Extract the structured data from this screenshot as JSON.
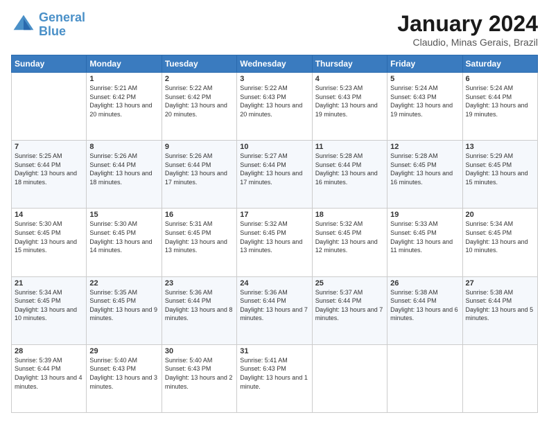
{
  "header": {
    "logo_line1": "General",
    "logo_line2": "Blue",
    "month": "January 2024",
    "location": "Claudio, Minas Gerais, Brazil"
  },
  "weekdays": [
    "Sunday",
    "Monday",
    "Tuesday",
    "Wednesday",
    "Thursday",
    "Friday",
    "Saturday"
  ],
  "weeks": [
    [
      {
        "day": "",
        "sunrise": "",
        "sunset": "",
        "daylight": ""
      },
      {
        "day": "1",
        "sunrise": "Sunrise: 5:21 AM",
        "sunset": "Sunset: 6:42 PM",
        "daylight": "Daylight: 13 hours and 20 minutes."
      },
      {
        "day": "2",
        "sunrise": "Sunrise: 5:22 AM",
        "sunset": "Sunset: 6:42 PM",
        "daylight": "Daylight: 13 hours and 20 minutes."
      },
      {
        "day": "3",
        "sunrise": "Sunrise: 5:22 AM",
        "sunset": "Sunset: 6:43 PM",
        "daylight": "Daylight: 13 hours and 20 minutes."
      },
      {
        "day": "4",
        "sunrise": "Sunrise: 5:23 AM",
        "sunset": "Sunset: 6:43 PM",
        "daylight": "Daylight: 13 hours and 19 minutes."
      },
      {
        "day": "5",
        "sunrise": "Sunrise: 5:24 AM",
        "sunset": "Sunset: 6:43 PM",
        "daylight": "Daylight: 13 hours and 19 minutes."
      },
      {
        "day": "6",
        "sunrise": "Sunrise: 5:24 AM",
        "sunset": "Sunset: 6:44 PM",
        "daylight": "Daylight: 13 hours and 19 minutes."
      }
    ],
    [
      {
        "day": "7",
        "sunrise": "Sunrise: 5:25 AM",
        "sunset": "Sunset: 6:44 PM",
        "daylight": "Daylight: 13 hours and 18 minutes."
      },
      {
        "day": "8",
        "sunrise": "Sunrise: 5:26 AM",
        "sunset": "Sunset: 6:44 PM",
        "daylight": "Daylight: 13 hours and 18 minutes."
      },
      {
        "day": "9",
        "sunrise": "Sunrise: 5:26 AM",
        "sunset": "Sunset: 6:44 PM",
        "daylight": "Daylight: 13 hours and 17 minutes."
      },
      {
        "day": "10",
        "sunrise": "Sunrise: 5:27 AM",
        "sunset": "Sunset: 6:44 PM",
        "daylight": "Daylight: 13 hours and 17 minutes."
      },
      {
        "day": "11",
        "sunrise": "Sunrise: 5:28 AM",
        "sunset": "Sunset: 6:44 PM",
        "daylight": "Daylight: 13 hours and 16 minutes."
      },
      {
        "day": "12",
        "sunrise": "Sunrise: 5:28 AM",
        "sunset": "Sunset: 6:45 PM",
        "daylight": "Daylight: 13 hours and 16 minutes."
      },
      {
        "day": "13",
        "sunrise": "Sunrise: 5:29 AM",
        "sunset": "Sunset: 6:45 PM",
        "daylight": "Daylight: 13 hours and 15 minutes."
      }
    ],
    [
      {
        "day": "14",
        "sunrise": "Sunrise: 5:30 AM",
        "sunset": "Sunset: 6:45 PM",
        "daylight": "Daylight: 13 hours and 15 minutes."
      },
      {
        "day": "15",
        "sunrise": "Sunrise: 5:30 AM",
        "sunset": "Sunset: 6:45 PM",
        "daylight": "Daylight: 13 hours and 14 minutes."
      },
      {
        "day": "16",
        "sunrise": "Sunrise: 5:31 AM",
        "sunset": "Sunset: 6:45 PM",
        "daylight": "Daylight: 13 hours and 13 minutes."
      },
      {
        "day": "17",
        "sunrise": "Sunrise: 5:32 AM",
        "sunset": "Sunset: 6:45 PM",
        "daylight": "Daylight: 13 hours and 13 minutes."
      },
      {
        "day": "18",
        "sunrise": "Sunrise: 5:32 AM",
        "sunset": "Sunset: 6:45 PM",
        "daylight": "Daylight: 13 hours and 12 minutes."
      },
      {
        "day": "19",
        "sunrise": "Sunrise: 5:33 AM",
        "sunset": "Sunset: 6:45 PM",
        "daylight": "Daylight: 13 hours and 11 minutes."
      },
      {
        "day": "20",
        "sunrise": "Sunrise: 5:34 AM",
        "sunset": "Sunset: 6:45 PM",
        "daylight": "Daylight: 13 hours and 10 minutes."
      }
    ],
    [
      {
        "day": "21",
        "sunrise": "Sunrise: 5:34 AM",
        "sunset": "Sunset: 6:45 PM",
        "daylight": "Daylight: 13 hours and 10 minutes."
      },
      {
        "day": "22",
        "sunrise": "Sunrise: 5:35 AM",
        "sunset": "Sunset: 6:45 PM",
        "daylight": "Daylight: 13 hours and 9 minutes."
      },
      {
        "day": "23",
        "sunrise": "Sunrise: 5:36 AM",
        "sunset": "Sunset: 6:44 PM",
        "daylight": "Daylight: 13 hours and 8 minutes."
      },
      {
        "day": "24",
        "sunrise": "Sunrise: 5:36 AM",
        "sunset": "Sunset: 6:44 PM",
        "daylight": "Daylight: 13 hours and 7 minutes."
      },
      {
        "day": "25",
        "sunrise": "Sunrise: 5:37 AM",
        "sunset": "Sunset: 6:44 PM",
        "daylight": "Daylight: 13 hours and 7 minutes."
      },
      {
        "day": "26",
        "sunrise": "Sunrise: 5:38 AM",
        "sunset": "Sunset: 6:44 PM",
        "daylight": "Daylight: 13 hours and 6 minutes."
      },
      {
        "day": "27",
        "sunrise": "Sunrise: 5:38 AM",
        "sunset": "Sunset: 6:44 PM",
        "daylight": "Daylight: 13 hours and 5 minutes."
      }
    ],
    [
      {
        "day": "28",
        "sunrise": "Sunrise: 5:39 AM",
        "sunset": "Sunset: 6:44 PM",
        "daylight": "Daylight: 13 hours and 4 minutes."
      },
      {
        "day": "29",
        "sunrise": "Sunrise: 5:40 AM",
        "sunset": "Sunset: 6:43 PM",
        "daylight": "Daylight: 13 hours and 3 minutes."
      },
      {
        "day": "30",
        "sunrise": "Sunrise: 5:40 AM",
        "sunset": "Sunset: 6:43 PM",
        "daylight": "Daylight: 13 hours and 2 minutes."
      },
      {
        "day": "31",
        "sunrise": "Sunrise: 5:41 AM",
        "sunset": "Sunset: 6:43 PM",
        "daylight": "Daylight: 13 hours and 1 minute."
      },
      {
        "day": "",
        "sunrise": "",
        "sunset": "",
        "daylight": ""
      },
      {
        "day": "",
        "sunrise": "",
        "sunset": "",
        "daylight": ""
      },
      {
        "day": "",
        "sunrise": "",
        "sunset": "",
        "daylight": ""
      }
    ]
  ]
}
